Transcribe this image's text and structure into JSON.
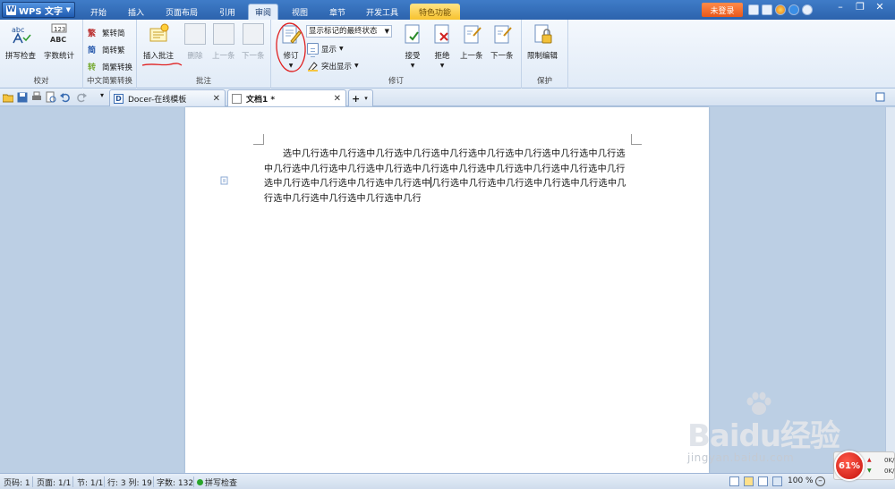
{
  "app": {
    "name": "WPS 文字"
  },
  "menu_tabs": [
    "开始",
    "插入",
    "页面布局",
    "引用",
    "审阅",
    "视图",
    "章节",
    "开发工具",
    "特色功能"
  ],
  "titlebar": {
    "login": "未登录"
  },
  "ribbon": {
    "proofing": {
      "group_label": "校对",
      "spell_check": "拼写检查",
      "word_count": "字数统计"
    },
    "chinese_convert": {
      "group_label": "中文简繁转换",
      "to_simplified": "繁转简",
      "to_traditional": "简转繁",
      "convert": "简繁转换"
    },
    "comments": {
      "group_label": "批注",
      "insert": "插入批注",
      "delete": "删除",
      "previous": "上一条",
      "next": "下一条"
    },
    "tracking": {
      "group_label": "修订",
      "track_changes": "修订",
      "display_mode": "显示标记的最终状态",
      "show": "显示",
      "highlight": "突出显示",
      "accept": "接受",
      "reject": "拒绝",
      "previous": "上一条",
      "next": "下一条"
    },
    "protect": {
      "group_label": "保护",
      "restrict_edit": "限制编辑"
    }
  },
  "doc_tabs": [
    {
      "title": "Docer-在线模板",
      "active": false
    },
    {
      "title": "文档1 *",
      "active": true
    }
  ],
  "document": {
    "before_caret": "选中几行选中几行选中几行选中几行选中几行选中几行选中几行选中几行选中几行选中几行选中几行选中几行选中几行选中几行选中几行选中几行选中几行选中几行选中几行选中几行选中几行选中几行选中几行选中",
    "after_caret": "几行选中几行选中几行选中几行选中几行选中几行选中几行选中几行选中几行选中几行"
  },
  "status": {
    "page_num": "页码: 1",
    "pages": "页面: 1/1",
    "section": "节: 1/1",
    "row_col": "行: 3  列: 19",
    "char_count": "字数: 132",
    "spell_check": "拼写检查",
    "zoom": "100 %"
  },
  "watermark": {
    "title": "Baidu经验",
    "url": "jingyan.baidu.com"
  },
  "net_widget": {
    "percent": "61%",
    "up": "0K/",
    "down": "0K/"
  },
  "colors": {
    "title_blue": "#2c63ad",
    "ribbon_bg": "#eaf1fa",
    "workspace": "#bccfe4",
    "annotation_red": "#e02020",
    "login_orange": "#e8581a",
    "special_tab_yellow": "#f7c22e"
  }
}
